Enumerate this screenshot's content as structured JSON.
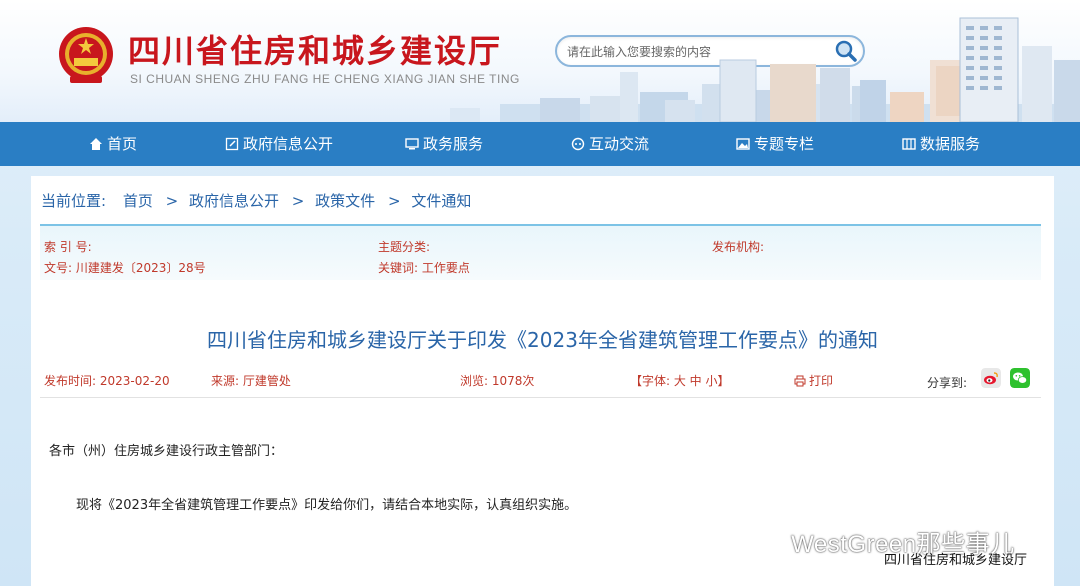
{
  "header": {
    "title": "四川省住房和城乡建设厅",
    "pinyin": "SI CHUAN SHENG ZHU FANG HE CHENG XIANG JIAN SHE TING",
    "search_placeholder": "请在此输入您要搜索的内容",
    "emblem_icon": "national-emblem-icon",
    "search_icon": "magnifier-icon"
  },
  "nav": {
    "items": [
      {
        "label": "首页",
        "icon": "home-icon"
      },
      {
        "label": "政府信息公开",
        "icon": "edit-icon"
      },
      {
        "label": "政务服务",
        "icon": "monitor-icon"
      },
      {
        "label": "互动交流",
        "icon": "chat-icon"
      },
      {
        "label": "专题专栏",
        "icon": "image-icon"
      },
      {
        "label": "数据服务",
        "icon": "grid-icon"
      }
    ]
  },
  "breadcrumb": {
    "prefix": "当前位置:",
    "items": [
      "首页",
      "政府信息公开",
      "政策文件",
      "文件通知"
    ],
    "separator": ">"
  },
  "meta": {
    "index_label": "索 引 号:",
    "topic_label": "主题分类:",
    "publisher_label": "发布机构:",
    "docno": "文号:  川建建发〔2023〕28号",
    "keywords": "关键词:  工作要点"
  },
  "article": {
    "title": "四川省住房和城乡建设厅关于印发《2023年全省建筑管理工作要点》的通知",
    "publish_time": "发布时间:  2023-02-20",
    "source": "来源:  厅建管处",
    "views": "浏览:  1078次",
    "font_size": "【字体:  大 中 小】",
    "print": "打印",
    "share_label": "分享到:",
    "greeting": "各市（州）住房城乡建设行政主管部门：",
    "paragraph": "现将《2023年全省建筑管理工作要点》印发给你们，请结合本地实际，认真组织实施。"
  },
  "watermark": {
    "main": "WestGreen那些事儿",
    "sub": "四川省住房和城乡建设厅"
  },
  "colors": {
    "nav_bg": "#2a7ec4",
    "title_red": "#c8161d",
    "link_blue": "#2a65a8",
    "meta_red": "#c0392b"
  }
}
